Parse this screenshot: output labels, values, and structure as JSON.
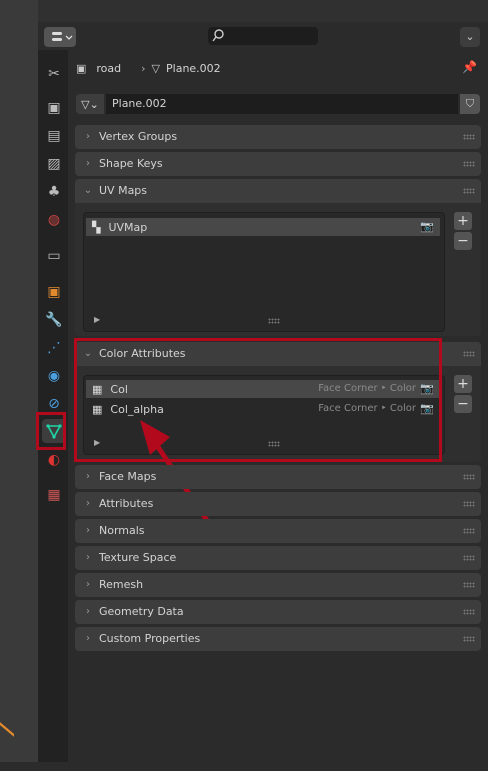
{
  "breadcrumb": {
    "object": "road",
    "mesh": "Plane.002"
  },
  "datablock": {
    "name": "Plane.002"
  },
  "panels": {
    "vertex_groups": "Vertex Groups",
    "shape_keys": "Shape Keys",
    "uv_maps": "UV Maps",
    "color_attributes": "Color Attributes",
    "face_maps": "Face Maps",
    "attributes": "Attributes",
    "normals": "Normals",
    "texture_space": "Texture Space",
    "remesh": "Remesh",
    "geometry_data": "Geometry Data",
    "custom_properties": "Custom Properties"
  },
  "uv_maps": [
    {
      "name": "UVMap"
    }
  ],
  "color_attributes": [
    {
      "name": "Col",
      "domain": "Face Corner ‣ Color"
    },
    {
      "name": "Col_alpha",
      "domain": "Face Corner ‣ Color"
    }
  ],
  "colors": {
    "highlight": "#b3091d",
    "active_tab": "#1fd6a6",
    "accent_orange": "#e08a2d"
  }
}
